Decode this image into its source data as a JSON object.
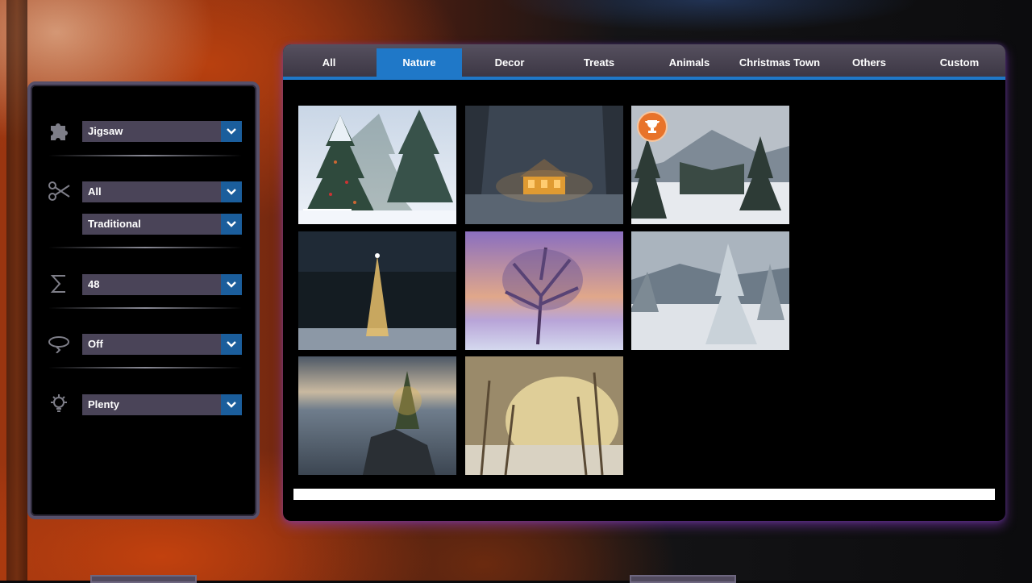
{
  "tabs": [
    {
      "label": "All",
      "active": false
    },
    {
      "label": "Nature",
      "active": true
    },
    {
      "label": "Decor",
      "active": false
    },
    {
      "label": "Treats",
      "active": false
    },
    {
      "label": "Animals",
      "active": false
    },
    {
      "label": "Christmas Town",
      "active": false
    },
    {
      "label": "Others",
      "active": false
    },
    {
      "label": "Custom",
      "active": false
    }
  ],
  "options": {
    "piece_shape": {
      "icon": "puzzle-piece-icon",
      "value": "Jigsaw"
    },
    "cut": {
      "icon": "scissors-icon",
      "value": "All"
    },
    "cut_style": {
      "value": "Traditional"
    },
    "piece_count": {
      "icon": "sigma-icon",
      "value": "48"
    },
    "rotation": {
      "icon": "rotate-icon",
      "value": "Off"
    },
    "hints": {
      "icon": "lightbulb-icon",
      "value": "Plenty"
    }
  },
  "puzzles": [
    {
      "scene": "snowy-christmas-tree",
      "completed": false
    },
    {
      "scene": "snowy-cabin-at-night",
      "completed": false
    },
    {
      "scene": "snowy-mountain-forest",
      "completed": true
    },
    {
      "scene": "lit-tree-night-forest",
      "completed": false
    },
    {
      "scene": "purple-sunset-tree",
      "completed": false
    },
    {
      "scene": "snow-covered-pines",
      "completed": false
    },
    {
      "scene": "tree-on-cliff-dusk",
      "completed": false
    },
    {
      "scene": "golden-snowy-forest",
      "completed": false
    }
  ],
  "colors": {
    "accent": "#1f78c8",
    "select_bg": "#4a4458",
    "panel_border": "#57506a",
    "badge": "#e8732a"
  }
}
